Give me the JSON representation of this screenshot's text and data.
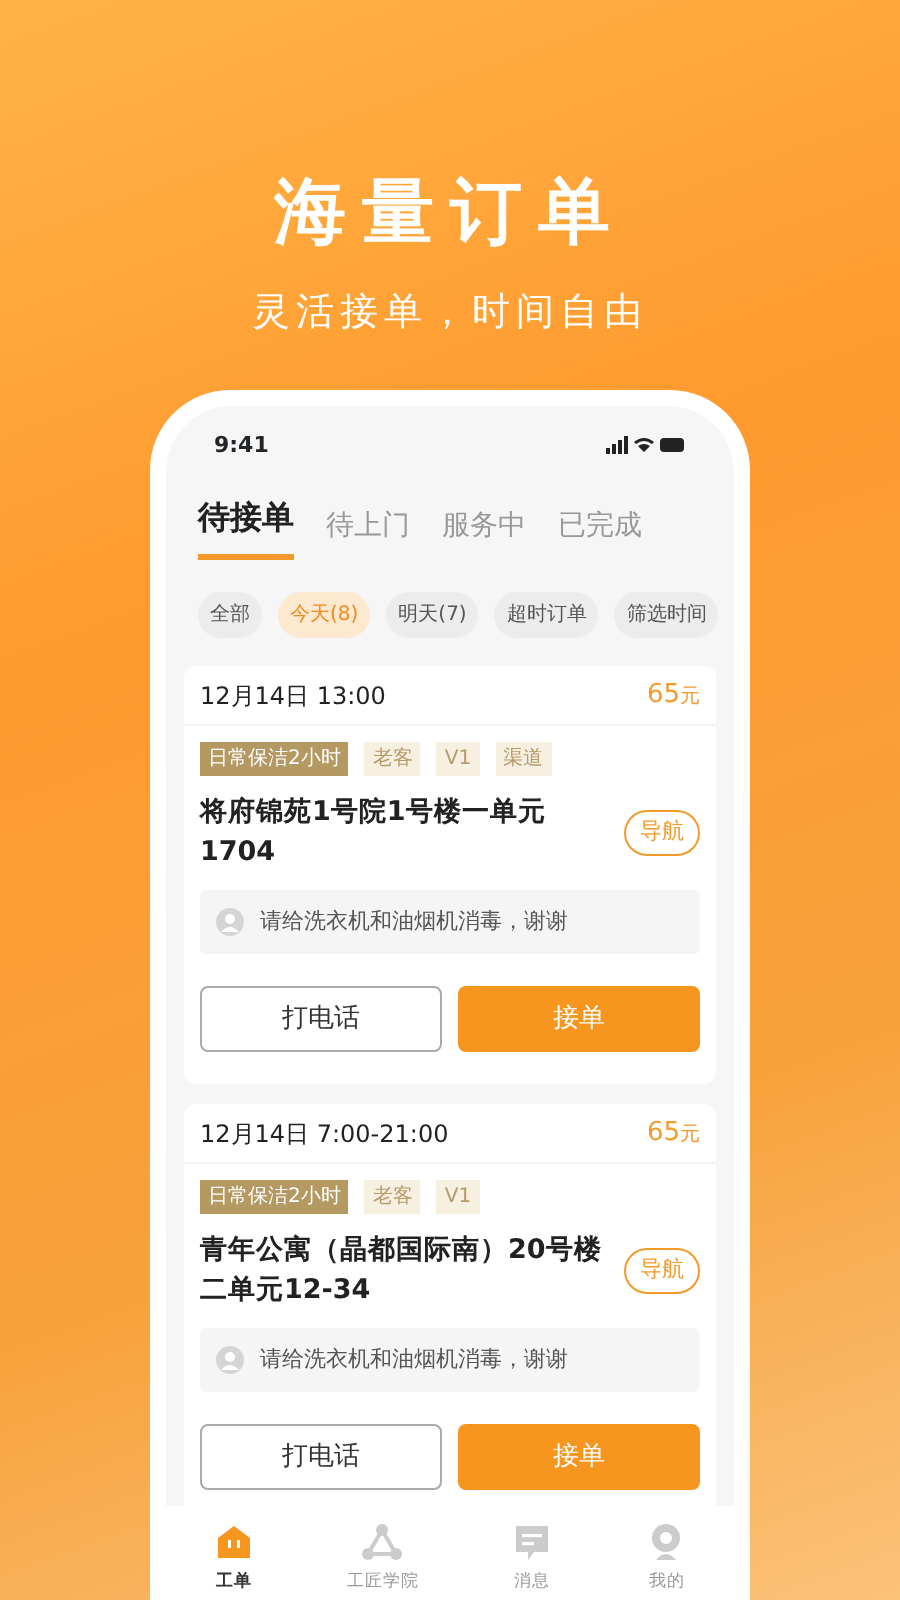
{
  "headline": "海量订单",
  "subheadline": "灵活接单，时间自由",
  "phone": {
    "status_time": "9:41",
    "tabs": [
      {
        "label": "待接单",
        "selected": true
      },
      {
        "label": "待上门",
        "selected": false
      },
      {
        "label": "服务中",
        "selected": false
      },
      {
        "label": "已完成",
        "selected": false
      }
    ],
    "filters": [
      {
        "label": "全部",
        "selected": false
      },
      {
        "label": "今天(8)",
        "selected": true
      },
      {
        "label": "明天(7)",
        "selected": false
      },
      {
        "label": "超时订单",
        "selected": false
      },
      {
        "label": "筛选时间",
        "selected": false
      }
    ],
    "orders": [
      {
        "time": "12月14日 13:00",
        "price": "65",
        "price_unit": "元",
        "tags": [
          {
            "label": "日常保洁2小时",
            "kind": "service"
          },
          {
            "label": "老客",
            "kind": "plain"
          },
          {
            "label": "V1",
            "kind": "plain"
          },
          {
            "label": "渠道",
            "kind": "plain"
          }
        ],
        "address": "将府锦苑1号院1号楼一单元1704",
        "nav_label": "导航",
        "note": "请给洗衣机和油烟机消毒，谢谢",
        "call_label": "打电话",
        "accept_label": "接单"
      },
      {
        "time": "12月14日 7:00-21:00",
        "price": "65",
        "price_unit": "元",
        "tags": [
          {
            "label": "日常保洁2小时",
            "kind": "service"
          },
          {
            "label": "老客",
            "kind": "plain"
          },
          {
            "label": "V1",
            "kind": "plain"
          }
        ],
        "address": "青年公寓（晶都国际南）20号楼二单元12-34",
        "nav_label": "导航",
        "note": "请给洗衣机和油烟机消毒，谢谢",
        "call_label": "打电话",
        "accept_label": "接单"
      }
    ],
    "bottom_nav": [
      {
        "label": "工单",
        "kind": "home",
        "selected": true
      },
      {
        "label": "工匠学院",
        "kind": "share",
        "selected": false
      },
      {
        "label": "消息",
        "kind": "message",
        "selected": false
      },
      {
        "label": "我的",
        "kind": "person",
        "selected": false
      }
    ]
  }
}
